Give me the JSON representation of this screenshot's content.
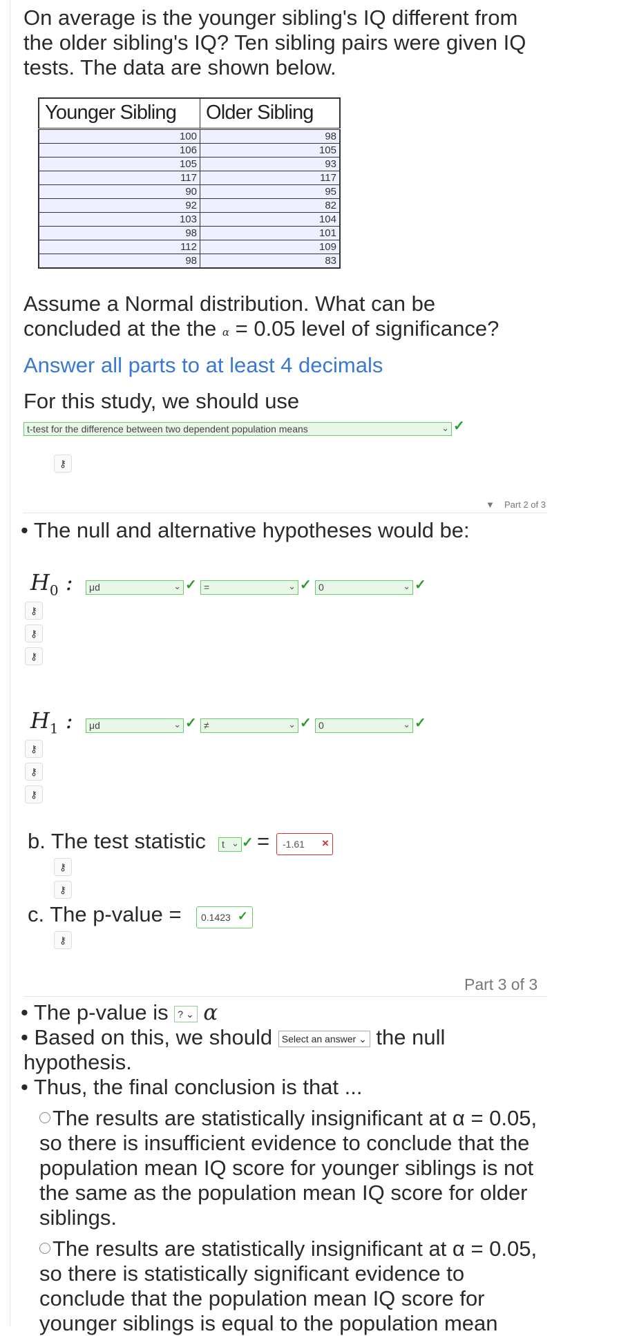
{
  "question": {
    "intro": "On average is the younger sibling's IQ different from the older sibling's IQ? Ten sibling pairs were given IQ tests. The data are shown below.",
    "table": {
      "headers": [
        "Younger Sibling",
        "Older Sibling"
      ],
      "rows": [
        [
          "100",
          "98"
        ],
        [
          "106",
          "105"
        ],
        [
          "105",
          "93"
        ],
        [
          "117",
          "117"
        ],
        [
          "90",
          "95"
        ],
        [
          "92",
          "82"
        ],
        [
          "103",
          "104"
        ],
        [
          "98",
          "101"
        ],
        [
          "112",
          "109"
        ],
        [
          "98",
          "83"
        ]
      ]
    },
    "assume_line1": "Assume a Normal distribution.  What can be",
    "assume_line2_pre": "concluded at the the",
    "alpha_symbol": "α",
    "assume_line2_post": "= 0.05 level of significance?",
    "answer_note": "Answer all parts to at least 4 decimals",
    "use_label": "For this study, we should use",
    "test_select": "t-test for the difference between two dependent population means"
  },
  "part2": {
    "label": "Part 2 of 3",
    "bullet": "The null and alternative hypotheses would be:",
    "h0": {
      "label": "H",
      "sub": "0",
      "param": "μd",
      "op": "=",
      "value": "0"
    },
    "h1": {
      "label": "H",
      "sub": "1",
      "param": "μd",
      "op": "≠",
      "value": "0"
    },
    "b_label": "b. The test statistic",
    "b_stat": "t",
    "b_eq": "=",
    "b_value": "-1.61",
    "c_label": "c. The p-value =",
    "c_value": "0.1423"
  },
  "part3": {
    "label": "Part 3 of 3",
    "p_is": "The p-value is",
    "p_select": "?",
    "alpha": "α",
    "based_pre": "Based on this, we should",
    "based_select": "Select an answer",
    "based_post": "the null",
    "based_line2": "hypothesis.",
    "thus": "Thus, the final conclusion is that ...",
    "option1": "The results are statistically insignificant at α = 0.05, so there is insufficient evidence to conclude that the population mean IQ score for younger siblings is not the same as the population mean IQ score for older siblings.",
    "option2": "The results are statistically insignificant at α = 0.05, so there is statistically significant evidence to conclude that the population mean IQ score for younger siblings is equal to the population mean"
  },
  "icons": {
    "key": "key-icon",
    "check": "check-icon",
    "x": "x-icon",
    "chevron": "chevron-down-icon"
  },
  "colors": {
    "correct_border": "#66cc66",
    "correct_bg": "#e9f7e9",
    "wrong_border": "#cc3333",
    "link_blue": "#3a78d8"
  }
}
